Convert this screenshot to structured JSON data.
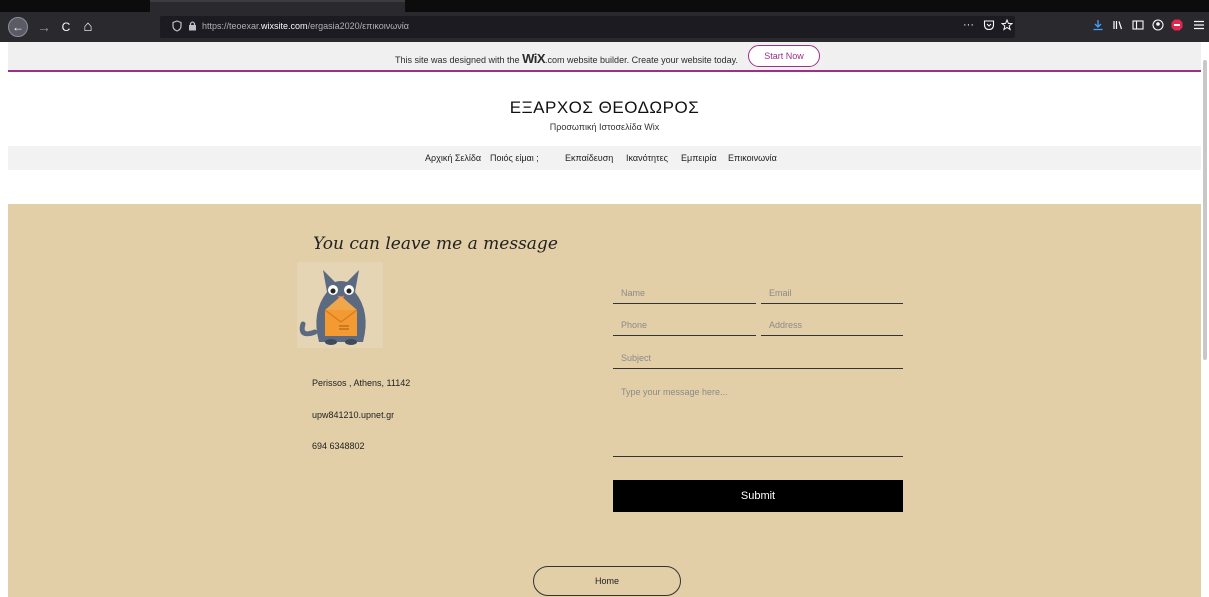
{
  "browser": {
    "url_prefix": "https://teoexar.",
    "url_host": "wixsite.com",
    "url_path": "/ergasia2020/επικοινωνία",
    "nav_back": "←",
    "nav_forward": "→",
    "nav_reload": "C",
    "nav_home": "⌂",
    "more_icon": "···"
  },
  "wix_banner": {
    "text_before": "This site was designed with the ",
    "logo": "WiX",
    "text_after": ".com website builder. Create your website today.",
    "cta": "Start Now"
  },
  "header": {
    "title": "ΕΞΑΡΧΟΣ ΘΕΟΔΩΡΟΣ",
    "subtitle": "Προσωπική Ιστοσελίδα Wix"
  },
  "nav": {
    "items": [
      "Αρχική Σελίδα",
      "Ποιός είμαι ;",
      "Εκπαίδευση",
      "Ικανότητες",
      "Εμπειρία",
      "Επικοινωνία"
    ]
  },
  "contact": {
    "heading": "You can leave me a message",
    "address": "Perissos , Athens, 11142",
    "email": "upw841210.upnet.gr",
    "phone": "694 6348802"
  },
  "form": {
    "name": "Name",
    "email": "Email",
    "phone": "Phone",
    "address": "Address",
    "subject": "Subject",
    "message": "Type your message here...",
    "submit": "Submit"
  },
  "footer": {
    "home": "Home"
  },
  "colors": {
    "content_bg": "#e2cfa8",
    "wix_accent": "#9b2f8a",
    "submit_bg": "#000000"
  }
}
